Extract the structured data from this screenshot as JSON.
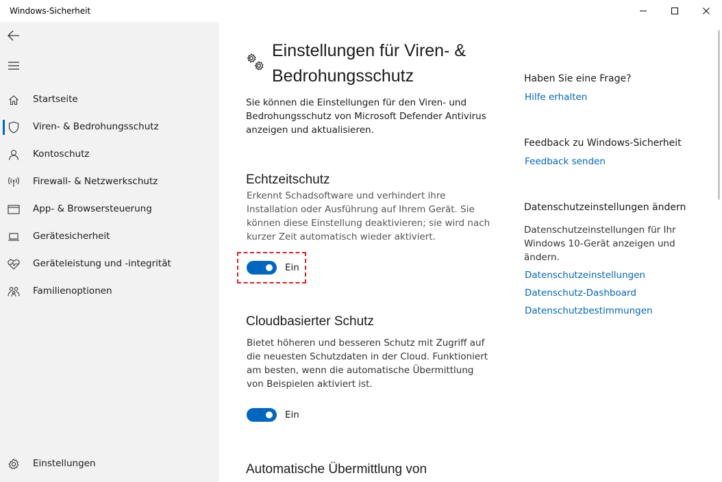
{
  "window": {
    "title": "Windows-Sicherheit"
  },
  "sidebar": {
    "items": [
      {
        "label": "Startseite",
        "icon": "home-icon"
      },
      {
        "label": "Viren- & Bedrohungsschutz",
        "icon": "shield-icon"
      },
      {
        "label": "Kontoschutz",
        "icon": "person-icon"
      },
      {
        "label": "Firewall- & Netzwerkschutz",
        "icon": "antenna-icon"
      },
      {
        "label": "App- & Browsersteuerung",
        "icon": "app-window-icon"
      },
      {
        "label": "Gerätesicherheit",
        "icon": "laptop-icon"
      },
      {
        "label": "Geräteleistung und -integrität",
        "icon": "heart-icon"
      },
      {
        "label": "Familienoptionen",
        "icon": "family-icon"
      }
    ],
    "active_index": 1,
    "settings_label": "Einstellungen"
  },
  "main": {
    "title": "Einstellungen für Viren- & Bedrohungsschutz",
    "intro": "Sie können die Einstellungen für den Viren- und Bedrohungsschutz von Microsoft Defender Antivirus anzeigen und aktualisieren.",
    "sections": [
      {
        "heading": "Echtzeitschutz",
        "text": "Erkennt Schadsoftware und verhindert ihre Installation oder Ausführung auf Ihrem Gerät. Sie können diese Einstellung deaktivieren; sie wird nach kurzer Zeit automatisch wieder aktiviert.",
        "toggle_label": "Ein",
        "toggle_on": true
      },
      {
        "heading": "Cloudbasierter Schutz",
        "text": "Bietet höheren und besseren Schutz mit Zugriff auf die neuesten Schutzdaten in der Cloud. Funktioniert am besten, wenn die automatische Übermittlung von Beispielen aktiviert ist.",
        "toggle_label": "Ein",
        "toggle_on": true
      },
      {
        "heading": "Automatische Übermittlung von"
      }
    ]
  },
  "aside": {
    "question_heading": "Haben Sie eine Frage?",
    "help_link": "Hilfe erhalten",
    "feedback_heading": "Feedback zu Windows-Sicherheit",
    "feedback_link": "Feedback senden",
    "privacy_heading": "Datenschutzeinstellungen ändern",
    "privacy_text": "Datenschutzeinstellungen für Ihr Windows 10-Gerät anzeigen und ändern.",
    "privacy_links": [
      "Datenschutzeinstellungen",
      "Datenschutz-Dashboard",
      "Datenschutzbestimmungen"
    ]
  },
  "colors": {
    "accent": "#0067c0",
    "highlight": "#d32020",
    "sidebar_bg": "#f2f2f2"
  }
}
